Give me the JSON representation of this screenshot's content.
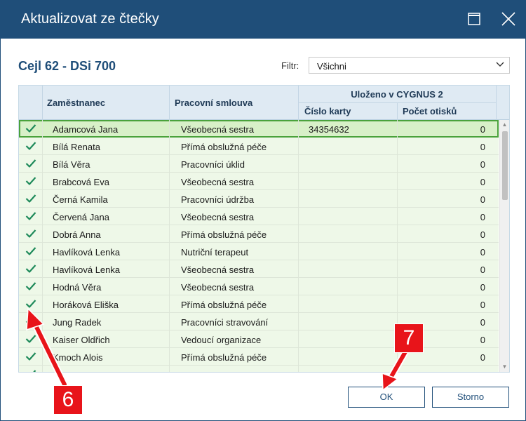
{
  "window": {
    "title": "Aktualizovat ze čtečky"
  },
  "heading": "Cejl 62 - DSi 700",
  "filter": {
    "label": "Filtr:",
    "value": "Všichni"
  },
  "table": {
    "headers": {
      "employee": "Zaměstnanec",
      "contract": "Pracovní smlouva",
      "group": "Uloženo v CYGNUS 2",
      "card": "Číslo karty",
      "prints": "Počet otisků"
    },
    "rows": [
      {
        "name": "Adamcová Jana",
        "contract": "Všeobecná sestra",
        "card": "34354632",
        "prints": "0",
        "checked": true,
        "selected": true
      },
      {
        "name": "Bílá Renata",
        "contract": "Přímá obslužná péče",
        "card": "",
        "prints": "0",
        "checked": true
      },
      {
        "name": "Bílá Věra",
        "contract": "Pracovníci úklid",
        "card": "",
        "prints": "0",
        "checked": true
      },
      {
        "name": "Brabcová Eva",
        "contract": "Všeobecná sestra",
        "card": "",
        "prints": "0",
        "checked": true
      },
      {
        "name": "Černá Kamila",
        "contract": "Pracovníci údržba",
        "card": "",
        "prints": "0",
        "checked": true
      },
      {
        "name": "Červená Jana",
        "contract": "Všeobecná sestra",
        "card": "",
        "prints": "0",
        "checked": true
      },
      {
        "name": "Dobrá Anna",
        "contract": "Přímá obslužná péče",
        "card": "",
        "prints": "0",
        "checked": true
      },
      {
        "name": "Havlíková Lenka",
        "contract": "Nutriční terapeut",
        "card": "",
        "prints": "0",
        "checked": true
      },
      {
        "name": "Havlíková Lenka",
        "contract": "Všeobecná sestra",
        "card": "",
        "prints": "0",
        "checked": true
      },
      {
        "name": "Hodná Věra",
        "contract": "Všeobecná sestra",
        "card": "",
        "prints": "0",
        "checked": true
      },
      {
        "name": "Horáková Eliška",
        "contract": "Přímá obslužná péče",
        "card": "",
        "prints": "0",
        "checked": true
      },
      {
        "name": "Jung Radek",
        "contract": "Pracovníci stravování",
        "card": "",
        "prints": "0",
        "checked": true
      },
      {
        "name": "Kaiser Oldřich",
        "contract": "Vedoucí organizace",
        "card": "",
        "prints": "0",
        "checked": true
      },
      {
        "name": "Kmoch Alois",
        "contract": "Přímá obslužná péče",
        "card": "",
        "prints": "0",
        "checked": true
      },
      {
        "name": "",
        "contract": "",
        "card": "",
        "prints": "",
        "checked": true
      }
    ]
  },
  "buttons": {
    "ok": "OK",
    "cancel": "Storno"
  },
  "annotations": [
    {
      "label": "6"
    },
    {
      "label": "7"
    }
  ],
  "colors": {
    "titlebar": "#1f4e79",
    "accent": "#1f4e79",
    "check": "#1e8a5a",
    "row_bg": "#eef8e8",
    "selected_outline": "#4aa23b",
    "marker": "#e8141a"
  },
  "icons": {
    "maximize": "maximize-icon",
    "close": "close-icon",
    "dropdown": "chevron-down-icon",
    "check": "checkmark-icon"
  }
}
